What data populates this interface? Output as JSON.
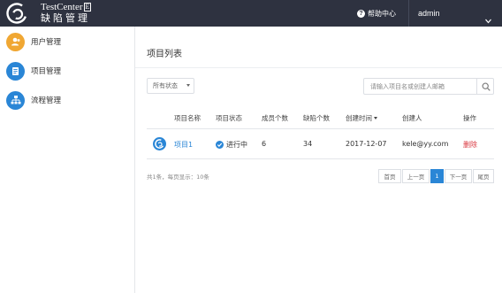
{
  "header": {
    "brand_line1": "TestCenter",
    "brand_badge": "E",
    "brand_line2": "缺陷管理",
    "help_label": "帮助中心",
    "help_icon": "question-icon",
    "user_name": "admin"
  },
  "sidebar": {
    "items": [
      {
        "label": "用户管理",
        "icon": "users-icon",
        "color": "#f0a733"
      },
      {
        "label": "项目管理",
        "icon": "document-icon",
        "color": "#2a86d6"
      },
      {
        "label": "流程管理",
        "icon": "flow-icon",
        "color": "#2a86d6"
      }
    ]
  },
  "main": {
    "title": "项目列表",
    "filter": {
      "selected": "所有状态"
    },
    "search": {
      "placeholder": "请输入项目名或创建人邮箱"
    },
    "table": {
      "columns": [
        "项目名称",
        "项目状态",
        "成员个数",
        "缺陷个数",
        "创建时间",
        "创建人",
        "操作"
      ],
      "rows": [
        {
          "name": "项目1",
          "status": "进行中",
          "members": "6",
          "defects": "34",
          "created": "2017-12-07",
          "creator": "kele@yy.com",
          "action": "删除"
        }
      ]
    },
    "summary": "共1条，每页显示：10条",
    "pagination": {
      "first": "首页",
      "prev": "上一页",
      "current": "1",
      "next": "下一页",
      "last": "尾页"
    }
  },
  "colors": {
    "topbar": "#2e3240",
    "accent": "#2a86d6",
    "danger": "#d9363e",
    "user_icon": "#f0a733"
  }
}
